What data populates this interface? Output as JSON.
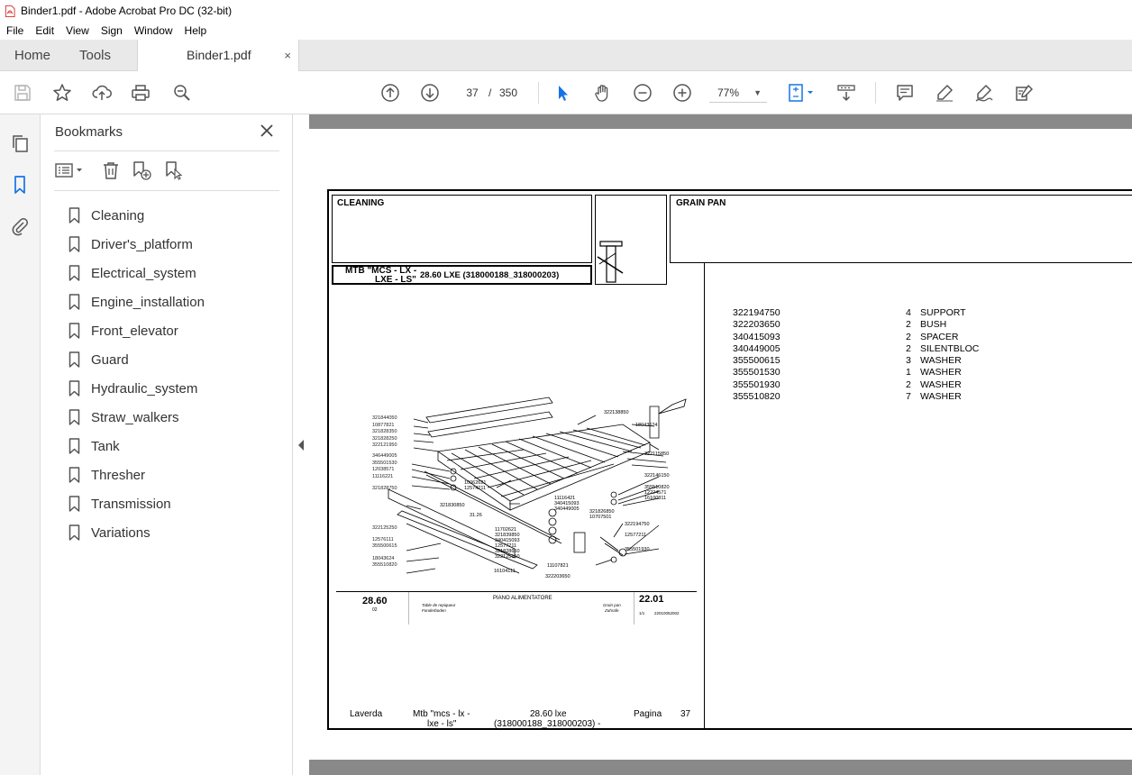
{
  "window": {
    "title": "Binder1.pdf - Adobe Acrobat Pro DC (32-bit)"
  },
  "menu": [
    "File",
    "Edit",
    "View",
    "Sign",
    "Window",
    "Help"
  ],
  "tabs": {
    "home": "Home",
    "tools": "Tools",
    "document": "Binder1.pdf",
    "close_symbol": "×"
  },
  "toolbar": {
    "current_page": "37",
    "page_separator": "/",
    "total_pages": "350",
    "zoom": "77%",
    "icons": [
      "save-icon",
      "star-icon",
      "upload-icon",
      "print-icon",
      "search-zoom-icon",
      "page-up-icon",
      "page-down-icon",
      "select-cursor-icon",
      "hand-icon",
      "zoom-out-icon",
      "zoom-in-icon",
      "fit-page-icon",
      "scroll-mode-icon",
      "comment-icon",
      "highlight-icon",
      "draw-icon",
      "sign-icon"
    ]
  },
  "bookmarks": {
    "title": "Bookmarks",
    "items": [
      "Cleaning",
      "Driver's_platform",
      "Electrical_system",
      "Engine_installation",
      "Front_elevator",
      "Guard",
      "Hydraulic_system",
      "Straw_walkers",
      "Tank",
      "Thresher",
      "Transmission",
      "Variations"
    ]
  },
  "pdf": {
    "section": "CLEANING",
    "group": "GRAIN PAN",
    "model_line1": "MTB \"MCS - LX -",
    "model_line2": "LXE - LS\"",
    "model_code": "28.60 LXE (318000188_318000203)",
    "parts": [
      {
        "code": "322194750",
        "qty": "4",
        "desc": "SUPPORT"
      },
      {
        "code": "322203650",
        "qty": "2",
        "desc": "BUSH"
      },
      {
        "code": "340415093",
        "qty": "2",
        "desc": "SPACER"
      },
      {
        "code": "340449005",
        "qty": "2",
        "desc": "SILENTBLOC"
      },
      {
        "code": "355500615",
        "qty": "3",
        "desc": "WASHER"
      },
      {
        "code": "355501530",
        "qty": "1",
        "desc": "WASHER"
      },
      {
        "code": "355501930",
        "qty": "2",
        "desc": "WASHER"
      },
      {
        "code": "355510820",
        "qty": "7",
        "desc": "WASHER"
      }
    ],
    "drawing": {
      "model": "28.60",
      "model_sub": "02",
      "title_it": "PIANO ALIMENTATORE",
      "title_small1": "Table de repiqueur",
      "title_small2": "Fonderboden",
      "title_small3": "Grain pan",
      "title_small4": "Zuhrafe",
      "ref": "22.01",
      "ref_sub1": "1/1",
      "ref_sub2": "22010052002",
      "callouts_left": [
        "321844050",
        "10877821",
        "321828350",
        "321828250",
        "322121950",
        "346449005",
        "355501530",
        "12038571",
        "11116221",
        "321828750",
        "322125250",
        "12576111",
        "355500615",
        "18043624",
        "355510820"
      ],
      "callouts_right": [
        "322138850",
        "18043624",
        "322115850",
        "322146150",
        "355510820",
        "12224571",
        "16100811",
        "11116421",
        "340415093",
        "340449005",
        "321826850",
        "10707501",
        "322194750",
        "12577211",
        "355501930",
        "11107821",
        "322203650",
        "10062621",
        "12574211",
        "321830850",
        "11702621",
        "321839850",
        "340415093",
        "12577211",
        "321828650",
        "322125150",
        "16104111",
        "31.26"
      ]
    },
    "footer": {
      "brand": "Laverda",
      "model1": "Mtb \"mcs - lx -",
      "model2": "lxe - ls\"",
      "code1": "28.60 lxe",
      "code2": "(318000188_318000203)  -",
      "page_label": "Pagina",
      "page_num": "37"
    }
  }
}
